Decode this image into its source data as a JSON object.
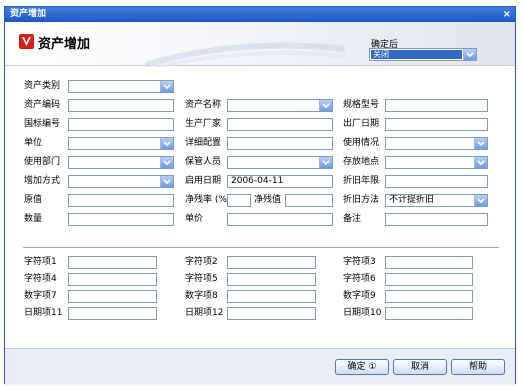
{
  "window": {
    "title": "资产增加",
    "close_glyph": "×"
  },
  "header": {
    "title": "资产增加",
    "logo_icon": "app-logo-icon",
    "after_label": "确定后",
    "after_value": "关闭"
  },
  "fields": {
    "asset_type": {
      "label": "资产类别",
      "value": ""
    },
    "asset_code": {
      "label": "资产编码",
      "value": ""
    },
    "asset_name": {
      "label": "资产名称",
      "value": ""
    },
    "spec": {
      "label": "规格型号",
      "value": ""
    },
    "national_code": {
      "label": "国标编号",
      "value": ""
    },
    "manufacturer": {
      "label": "生产厂家",
      "value": ""
    },
    "mfg_date": {
      "label": "出厂日期",
      "value": ""
    },
    "unit": {
      "label": "单位",
      "value": ""
    },
    "config": {
      "label": "详细配置",
      "value": ""
    },
    "usage_status": {
      "label": "使用情况",
      "value": ""
    },
    "dept": {
      "label": "使用部门",
      "value": ""
    },
    "keeper": {
      "label": "保管人员",
      "value": ""
    },
    "location": {
      "label": "存放地点",
      "value": ""
    },
    "add_method": {
      "label": "增加方式",
      "value": ""
    },
    "start_date": {
      "label": "启用日期",
      "value": "2006-04-11"
    },
    "dep_years": {
      "label": "折旧年限",
      "value": ""
    },
    "original": {
      "label": "原值",
      "value": ""
    },
    "residual_rate": {
      "label": "净残率 (%)",
      "value": ""
    },
    "residual_value": {
      "label": "净残值",
      "value": ""
    },
    "dep_method": {
      "label": "折旧方法",
      "value": "不计提折旧"
    },
    "quantity": {
      "label": "数量",
      "value": ""
    },
    "unit_price": {
      "label": "单价",
      "value": ""
    },
    "remark": {
      "label": "备注",
      "value": ""
    }
  },
  "custom": [
    {
      "label": "字符项1",
      "value": ""
    },
    {
      "label": "字符项2",
      "value": ""
    },
    {
      "label": "字符项3",
      "value": ""
    },
    {
      "label": "字符项4",
      "value": ""
    },
    {
      "label": "字符项5",
      "value": ""
    },
    {
      "label": "字符项6",
      "value": ""
    },
    {
      "label": "数字项7",
      "value": ""
    },
    {
      "label": "数字项8",
      "value": ""
    },
    {
      "label": "数字项9",
      "value": ""
    },
    {
      "label": "日期项11",
      "value": ""
    },
    {
      "label": "日期项12",
      "value": ""
    },
    {
      "label": "日期项10",
      "value": ""
    }
  ],
  "buttons": {
    "ok": "确定 ①",
    "cancel": "取消",
    "help": "帮助"
  }
}
